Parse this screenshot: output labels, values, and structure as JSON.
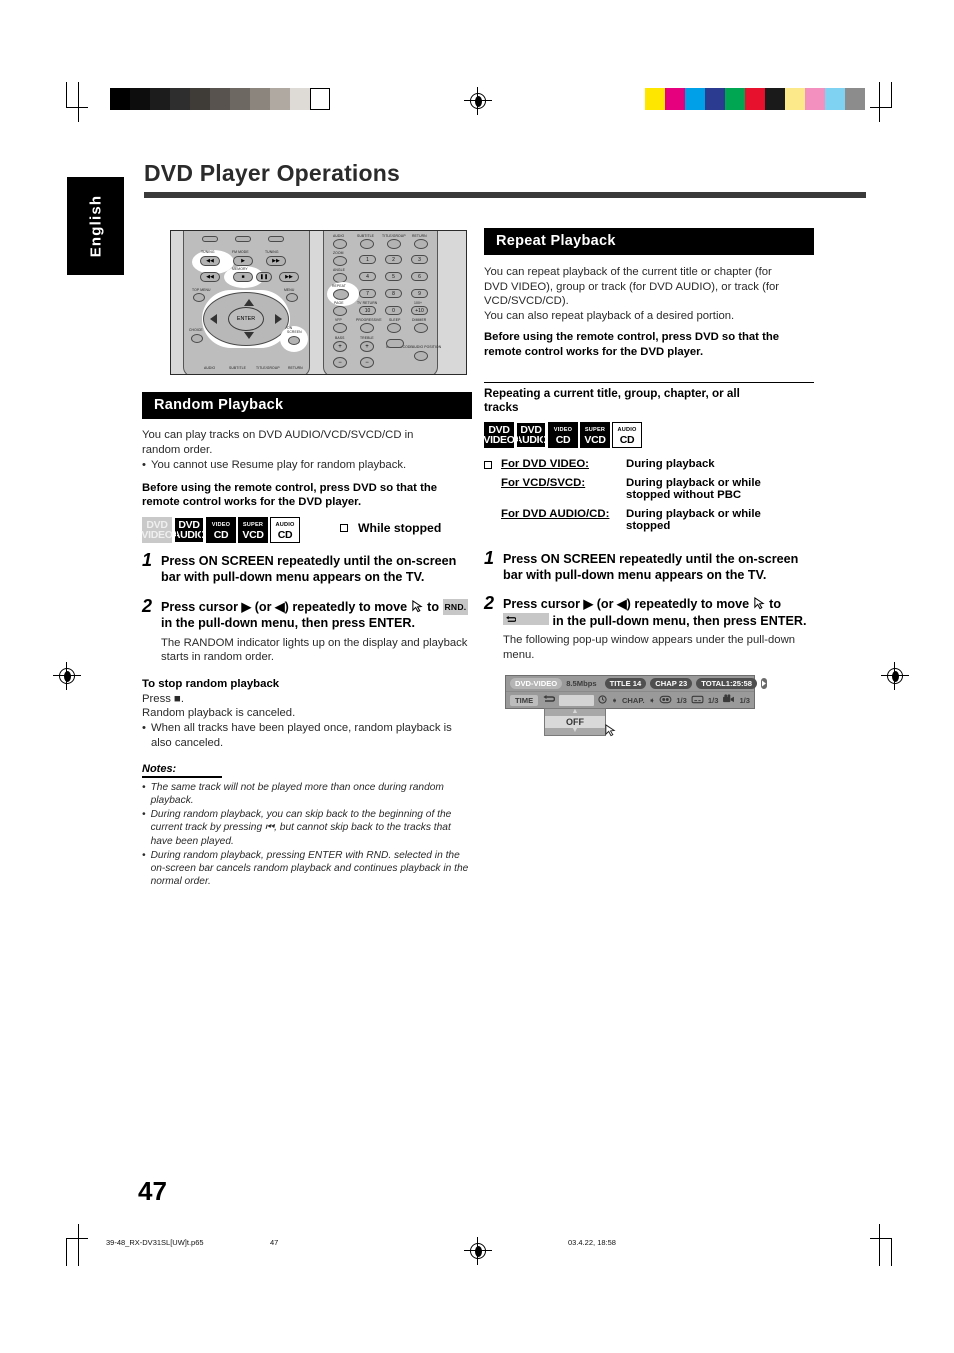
{
  "document": {
    "title": "DVD Player Operations",
    "language_tab": "English",
    "page_number": "47"
  },
  "footer": {
    "file_name": "39-48_RX-DV31SL[UW]t.p65",
    "page": "47",
    "timestamp": "03.4.22, 18:58"
  },
  "print_marks": {
    "gray_ramp": [
      "#000000",
      "#0d0d0d",
      "#1c1c1c",
      "#2e2e2e",
      "#3f3c38",
      "#58534e",
      "#6e6862",
      "#8c857e",
      "#b0a9a2",
      "#dedad6",
      "#ffffff"
    ],
    "color_ramp": [
      "#ffe600",
      "#e6007e",
      "#00a0e9",
      "#2b3b8f",
      "#00a651",
      "#e8112d",
      "#1a1a1a",
      "#fbe98a",
      "#f490c0",
      "#7fd2f2",
      "#8c8c8c"
    ]
  },
  "remote": {
    "caption_labels": {
      "tuning_down": "TUNING",
      "fm_mode": "FM MODE",
      "tuning_up": "TUNING",
      "memory": "MEMORY",
      "top_menu": "TOP MENU",
      "menu": "MENU",
      "choice": "CHOICE",
      "enter": "ENTER",
      "on_screen": "ON SCREEN",
      "audio": "AUDIO",
      "subtitle": "SUBTITLE",
      "title_group": "TITLE/GROUP",
      "return": "RETURN",
      "zoom": "ZOOM",
      "angle": "ANGLE",
      "repeat": "REPEAT",
      "page": "PAGE",
      "tv_return": "TV RETURN",
      "plus10": "100+",
      "vfp": "VFP",
      "progressive": "PROGRESSIVE",
      "sleep": "SLEEP",
      "dimmer": "DIMMER",
      "bass": "BASS",
      "treble": "TREBLE",
      "input_decode": "INPUT DECODE",
      "audio_position": "AUDIO POSITION"
    },
    "numbers": [
      "1",
      "2",
      "3",
      "4",
      "5",
      "6",
      "7",
      "8",
      "9",
      "10",
      "0",
      "+10"
    ]
  },
  "random_playback": {
    "heading": "Random Playback",
    "intro_line1": "You can play tracks on DVD AUDIO/VCD/SVCD/CD in",
    "intro_line2": "random order.",
    "bullet": "You cannot use Resume play for random playback.",
    "warning_line1": "Before using the remote control, press DVD so that the",
    "warning_line2": "remote control works for the DVD player.",
    "discs": [
      {
        "top": "DVD",
        "bottom": "VIDEO",
        "style": "off"
      },
      {
        "top": "DVD",
        "bottom": "AUDIO",
        "style": "onb"
      },
      {
        "top": "VIDEO",
        "bottom": "CD",
        "style": "on"
      },
      {
        "top": "SUPER",
        "bottom": "VCD",
        "style": "on"
      },
      {
        "top": "AUDIO",
        "bottom": "CD",
        "style": "inv"
      }
    ],
    "condition": "While stopped",
    "steps": [
      {
        "num": "1",
        "text": "Press ON SCREEN repeatedly until the on-screen bar with pull-down menu appears on the TV."
      },
      {
        "num": "2",
        "text_a": "Press cursor ▶ (or ◀) repeatedly to move",
        "text_b": "to",
        "chip": "RND.",
        "text_c": "in the pull-down menu, then press ENTER.",
        "sub": "The RANDOM indicator lights up on the display and playback starts in random order."
      }
    ],
    "stop": {
      "heading": "To stop random playback",
      "line1": "Press ■.",
      "line2": "Random playback is canceled.",
      "bullet": "When all tracks have been played once, random playback is also canceled."
    },
    "notes_title": "Notes:",
    "notes": [
      "The same track will not be played more than once during random playback.",
      "During random playback, you can skip back to the beginning of the current track by pressing ⏮, but cannot skip back to the tracks that have been played.",
      "During random playback, pressing ENTER with  RND.  selected in the on-screen bar cancels random playback and continues playback in the normal order."
    ]
  },
  "repeat_playback": {
    "heading": "Repeat Playback",
    "intro_line1": "You can repeat playback of the current title or chapter (for",
    "intro_line2": "DVD VIDEO), group or track (for DVD AUDIO), or track (for",
    "intro_line3": "VCD/SVCD/CD).",
    "intro_line4": "You can also repeat playback of a desired portion.",
    "warning_line1": "Before using the remote control, press DVD so that the",
    "warning_line2": "remote control works for the DVD player.",
    "subsection_line1": "Repeating a current title, group, chapter, or all",
    "subsection_line2": "tracks",
    "discs": [
      {
        "top": "DVD",
        "bottom": "VIDEO",
        "style": "on"
      },
      {
        "top": "DVD",
        "bottom": "AUDIO",
        "style": "onb"
      },
      {
        "top": "VIDEO",
        "bottom": "CD",
        "style": "on"
      },
      {
        "top": "SUPER",
        "bottom": "VCD",
        "style": "on"
      },
      {
        "top": "AUDIO",
        "bottom": "CD",
        "style": "inv"
      }
    ],
    "conditions": [
      {
        "label": "For DVD VIDEO:",
        "value": "During playback"
      },
      {
        "label": "For VCD/SVCD:",
        "value": "During playback or while stopped without PBC"
      },
      {
        "label": "For DVD AUDIO/CD:",
        "value": "During playback or while stopped"
      }
    ],
    "steps": [
      {
        "num": "1",
        "text": "Press ON SCREEN repeatedly until the on-screen bar with pull-down menu appears on the TV."
      },
      {
        "num": "2",
        "text_a": "Press cursor ▶ (or ◀) repeatedly to move",
        "text_b": "to",
        "text_c": "in the pull-down menu, then press ENTER.",
        "sub": "The following pop-up window appears under the pull-down menu."
      }
    ],
    "osd": {
      "disc_type": "DVD-VIDEO",
      "bitrate": "8.5Mbps",
      "title": "TITLE 14",
      "chapter": "CHAP 23",
      "total": "TOTAL1:25:58",
      "time_label": "TIME",
      "chap_label": "CHAP.",
      "audio_value": "1/3",
      "subtitle_value": "1/3",
      "angle_value": "1/3",
      "popup_value": "OFF"
    }
  }
}
